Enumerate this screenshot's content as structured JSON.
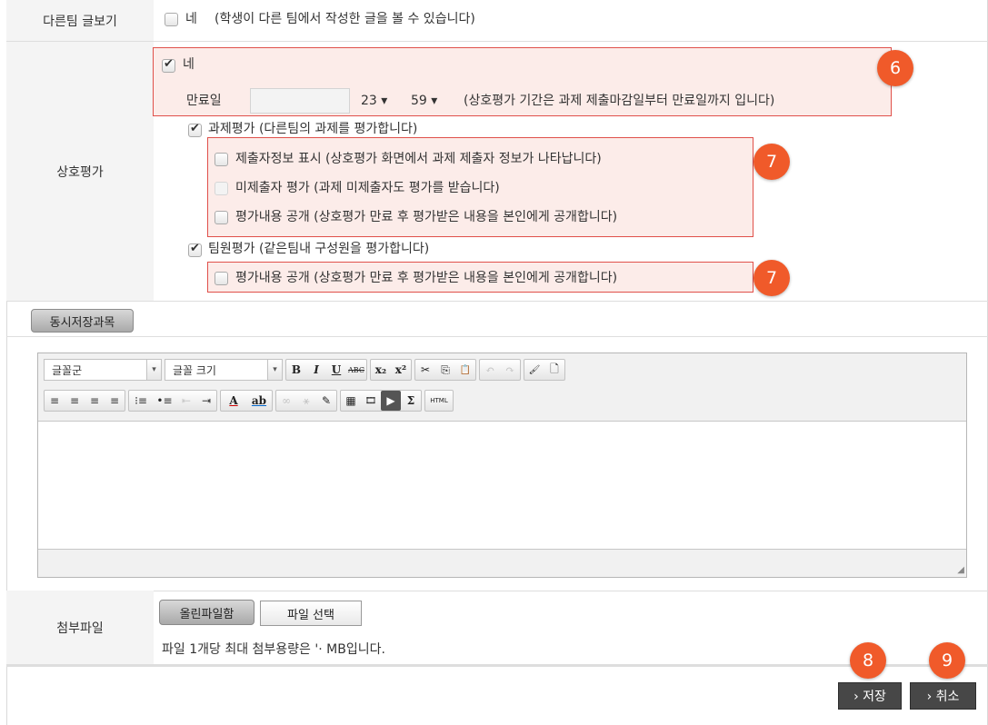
{
  "view_others": {
    "label": "다른팀 글보기",
    "option": "네",
    "description": "(학생이 다른 팀에서 작성한 글을 볼 수 있습니다)"
  },
  "peer_review": {
    "label": "상호평가",
    "enable_label": "네",
    "expiry_label": "만료일",
    "hour": "23 ▾",
    "minute": "59 ▾",
    "expiry_note": "(상호평가 기간은 과제 제출마감일부터 만료일까지 입니다)",
    "task_eval": "과제평가 (다른팀의 과제를 평가합니다)",
    "show_submitter": "제출자정보 표시 (상호평가 화면에서 과제 제출자 정보가 나타납니다)",
    "non_submitter": "미제출자 평가 (과제 미제출자도 평가를 받습니다)",
    "publish_result": "평가내용 공개 (상호평가 만료 후 평가받은 내용을 본인에게 공개합니다)",
    "member_eval": "팀원평가 (같은팀내 구성원을 평가합니다)",
    "member_publish": "평가내용 공개 (상호평가 만료 후 평가받은 내용을 본인에게 공개합니다)"
  },
  "badges": {
    "b6": "6",
    "b7a": "7",
    "b7b": "7",
    "b8": "8",
    "b9": "9"
  },
  "simul_save_button": "동시저장과목",
  "editor": {
    "font_combo": "글꼴군",
    "size_combo": "글꼴 크기",
    "row1": [
      "B",
      "I",
      "U",
      "ABC",
      "x₂",
      "x²",
      "✂",
      "⎘",
      "📋",
      "↶",
      "↷",
      "🖌",
      "🗋"
    ],
    "row2": [
      "≡",
      "≡",
      "≡",
      "≡",
      "⁝≡",
      "•≡",
      "⇤",
      "⇥",
      "A",
      "ab",
      "∞",
      "⚹",
      "✎",
      "▦",
      "🎞",
      "▶",
      "Σ",
      "HTML"
    ]
  },
  "attachment": {
    "label": "첨부파일",
    "uploaded_button": "올린파일함",
    "choose_button": "파일 선택",
    "note": "파일 1개당 최대 첨부용량은 '· MB입니다."
  },
  "actions": {
    "save": "› 저장",
    "cancel": "› 취소"
  },
  "colors": {
    "highlight_border": "#e0504a",
    "badge": "#f05a2a",
    "label_bg": "#f4f4f4"
  }
}
